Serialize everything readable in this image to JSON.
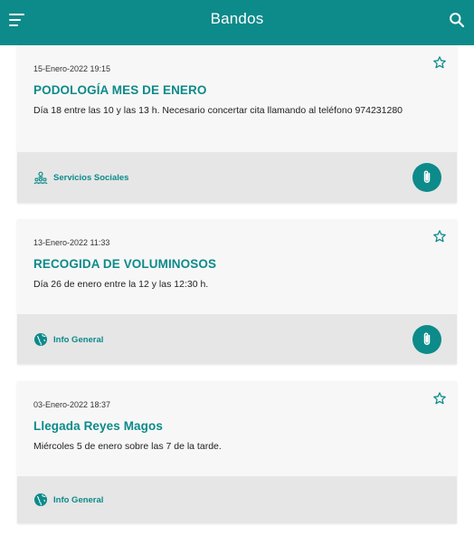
{
  "header": {
    "title": "Bandos",
    "menu_icon": "menu-icon",
    "search_icon": "search-icon",
    "brand_color": "#0d8a8a"
  },
  "bandos": [
    {
      "date": "15-Enero-2022 19:15",
      "title": "PODOLOGÍA MES DE ENERO",
      "text": "Día 18 entre las 10 y las 13 h. Necesario concertar cita llamando al teléfono 974231280",
      "category": "Servicios Sociales",
      "category_icon": "people-icon",
      "has_attachment": true
    },
    {
      "date": "13-Enero-2022 11:33",
      "title": "RECOGIDA DE VOLUMINOSOS",
      "text": "Día 26 de enero entre la 12 y las 12:30 h.",
      "category": "Info General",
      "category_icon": "globe-icon",
      "has_attachment": true
    },
    {
      "date": "03-Enero-2022 18:37",
      "title": "Llegada Reyes Magos",
      "text": "Miércoles 5 de enero sobre las 7 de la tarde.",
      "category": "Info General",
      "category_icon": "globe-icon",
      "has_attachment": false
    }
  ]
}
